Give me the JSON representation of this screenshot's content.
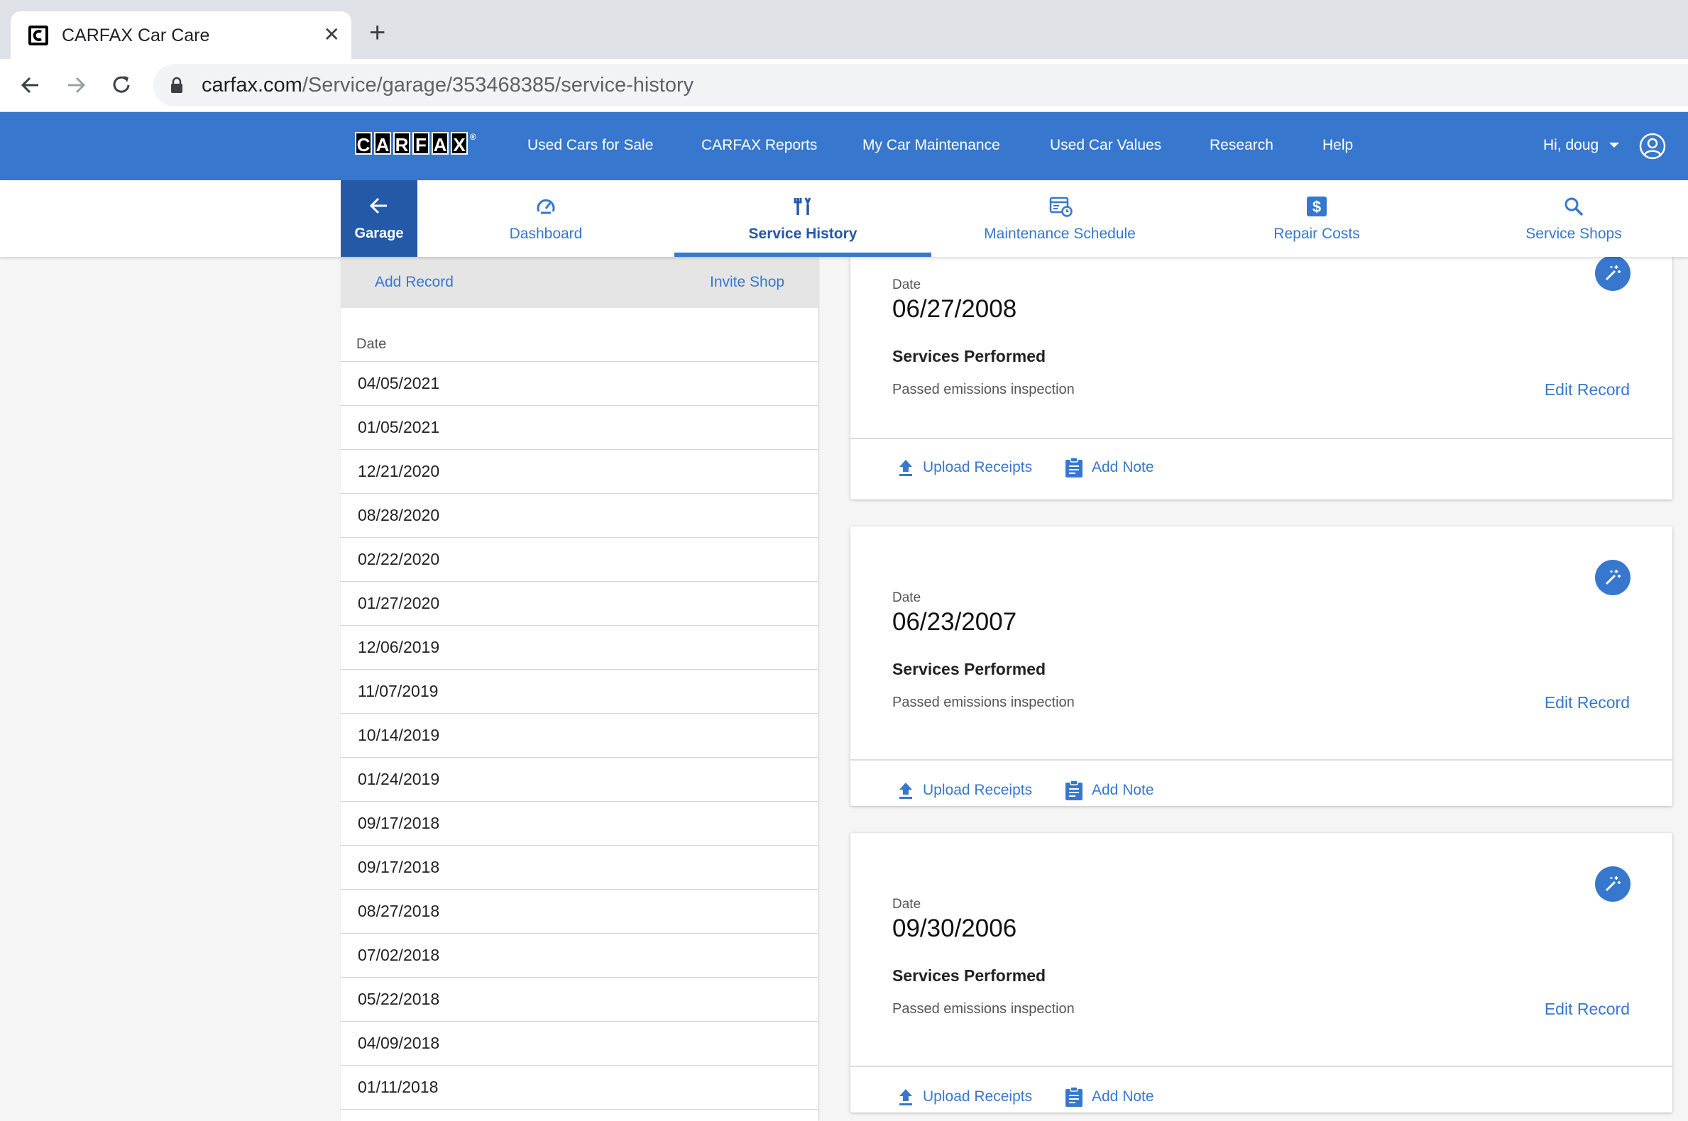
{
  "browser": {
    "tab_title": "CARFAX Car Care",
    "tab_close": "✕",
    "new_tab": "+",
    "url_host": "carfax.com",
    "url_path": "/Service/garage/353468385/service-history"
  },
  "header": {
    "logo_letters": [
      "C",
      "A",
      "R",
      "F",
      "A",
      "X"
    ],
    "logo_reg": "®",
    "links": [
      "Used Cars for Sale",
      "CARFAX Reports",
      "My Car Maintenance",
      "Used Car Values",
      "Research",
      "Help"
    ],
    "user_greeting": "Hi, doug"
  },
  "subnav": {
    "back_label": "Garage",
    "tabs": [
      "Dashboard",
      "Service History",
      "Maintenance Schedule",
      "Repair Costs",
      "Service Shops"
    ],
    "active_tab": "Service History"
  },
  "left_panel": {
    "add_record": "Add Record",
    "invite_shop": "Invite Shop",
    "date_header": "Date",
    "dates": [
      "04/05/2021",
      "01/05/2021",
      "12/21/2020",
      "08/28/2020",
      "02/22/2020",
      "01/27/2020",
      "12/06/2019",
      "11/07/2019",
      "10/14/2019",
      "01/24/2019",
      "09/17/2018",
      "09/17/2018",
      "08/27/2018",
      "07/02/2018",
      "05/22/2018",
      "04/09/2018",
      "01/11/2018"
    ]
  },
  "records": [
    {
      "date_label": "Date",
      "date": "06/27/2008",
      "services_label": "Services Performed",
      "services": "Passed emissions inspection",
      "edit": "Edit Record",
      "upload": "Upload Receipts",
      "note": "Add Note"
    },
    {
      "date_label": "Date",
      "date": "06/23/2007",
      "services_label": "Services Performed",
      "services": "Passed emissions inspection",
      "edit": "Edit Record",
      "upload": "Upload Receipts",
      "note": "Add Note"
    },
    {
      "date_label": "Date",
      "date": "09/30/2006",
      "services_label": "Services Performed",
      "services": "Passed emissions inspection",
      "edit": "Edit Record",
      "upload": "Upload Receipts",
      "note": "Add Note"
    }
  ],
  "colors": {
    "brand_blue": "#3777cd",
    "dark_blue": "#2459a8"
  }
}
